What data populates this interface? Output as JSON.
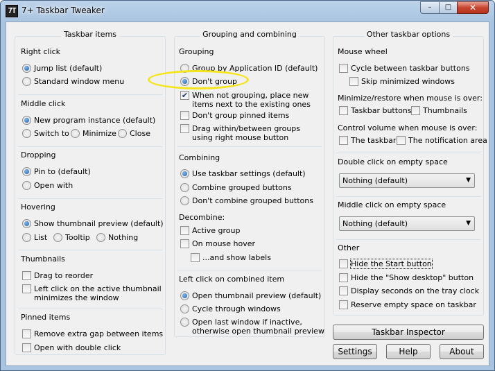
{
  "window": {
    "title": "7+ Taskbar Tweaker",
    "icon_text": "7T",
    "min": "–",
    "max": "□",
    "close": "✕"
  },
  "col1": {
    "title": "Taskbar items",
    "right_click": {
      "label": "Right click",
      "opts": [
        "Jump list (default)",
        "Standard window menu"
      ]
    },
    "middle_click": {
      "label": "Middle click",
      "opts": [
        "New program instance (default)",
        "Switch to",
        "Minimize",
        "Close"
      ]
    },
    "dropping": {
      "label": "Dropping",
      "opts": [
        "Pin to (default)",
        "Open with"
      ]
    },
    "hovering": {
      "label": "Hovering",
      "opts": [
        "Show thumbnail preview (default)",
        "List",
        "Tooltip",
        "Nothing"
      ]
    },
    "thumbnails": {
      "label": "Thumbnails",
      "opts": [
        "Drag to reorder",
        "Left click on the active thumbnail",
        "minimizes the window"
      ]
    },
    "pinned": {
      "label": "Pinned items",
      "opts": [
        "Remove extra gap between items",
        "Open with double click"
      ]
    }
  },
  "col2": {
    "title": "Grouping and combining",
    "grouping": {
      "label": "Grouping",
      "opts": [
        "Group by Application ID (default)",
        "Don't group",
        "When not grouping, place new",
        "items next to the existing ones",
        "Don't group pinned items",
        "Drag within/between groups",
        "using right mouse button"
      ]
    },
    "combining": {
      "label": "Combining",
      "opts": [
        "Use taskbar settings (default)",
        "Combine grouped buttons",
        "Don't combine grouped buttons"
      ]
    },
    "decombine": {
      "label": "Decombine:",
      "opts": [
        "Active group",
        "On mouse hover",
        "...and show labels"
      ]
    },
    "left_click": {
      "label": "Left click on combined item",
      "opts": [
        "Open thumbnail preview (default)",
        "Cycle through windows",
        "Open last window if inactive,",
        "otherwise open thumbnail preview"
      ]
    }
  },
  "col3": {
    "title": "Other taskbar options",
    "mouse_wheel": {
      "label": "Mouse wheel",
      "opts": [
        "Cycle between taskbar buttons",
        "Skip minimized windows"
      ]
    },
    "minimize": {
      "label": "Minimize/restore when mouse is over:",
      "opts": [
        "Taskbar buttons",
        "Thumbnails"
      ]
    },
    "volume": {
      "label": "Control volume when mouse is over:",
      "opts": [
        "The taskbar",
        "The notification area"
      ]
    },
    "dbl_click": {
      "label": "Double click on empty space",
      "value": "Nothing (default)"
    },
    "mid_click": {
      "label": "Middle click on empty space",
      "value": "Nothing (default)"
    },
    "other": {
      "label": "Other",
      "opts": [
        "Hide the Start button",
        "Hide the \"Show desktop\" button",
        "Display seconds on the tray clock",
        "Reserve empty space on taskbar"
      ]
    }
  },
  "buttons": {
    "inspector": "Taskbar Inspector",
    "settings": "Settings",
    "help": "Help",
    "about": "About"
  },
  "colors": {
    "annotation": "#f5e51c",
    "accent": "#1d5fa8"
  }
}
